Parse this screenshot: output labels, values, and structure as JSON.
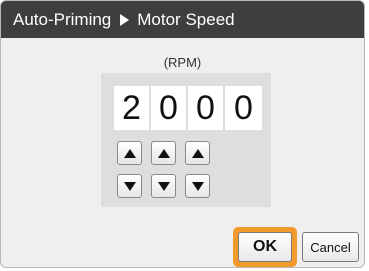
{
  "titlebar": {
    "crumb1": "Auto-Priming",
    "separator_icon": "right-triangle-icon",
    "crumb2": "Motor Speed"
  },
  "unit_label": "(RPM)",
  "speed": {
    "digits": [
      "2",
      "0",
      "0",
      "0"
    ]
  },
  "controls": {
    "up_icon": "up-arrow-icon",
    "down_icon": "down-arrow-icon"
  },
  "buttons": {
    "ok_label": "OK",
    "cancel_label": "Cancel"
  },
  "colors": {
    "titlebar_bg": "#3e3e3e",
    "focus_highlight": "#f39a2c"
  }
}
